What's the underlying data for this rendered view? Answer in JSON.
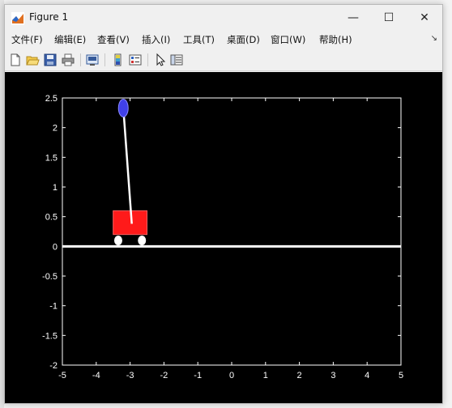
{
  "window": {
    "title": "Figure 1",
    "minimize": "—",
    "maximize": "☐",
    "close": "✕"
  },
  "menu": {
    "items": [
      {
        "label": "文件(F)"
      },
      {
        "label": "编辑(E)"
      },
      {
        "label": "查看(V)"
      },
      {
        "label": "插入(I)"
      },
      {
        "label": "工具(T)"
      },
      {
        "label": "桌面(D)"
      },
      {
        "label": "窗口(W)"
      },
      {
        "label": "帮助(H)"
      }
    ],
    "overflow_icon": "menu-overflow-arrow-icon"
  },
  "toolbar": {
    "icons": [
      "new-figure-icon",
      "open-file-icon",
      "save-icon",
      "print-icon",
      "link-plot-icon",
      "colorbar-icon",
      "legend-icon",
      "edit-plot-pointer-icon",
      "property-inspector-icon"
    ]
  },
  "chart_data": {
    "type": "scatter",
    "xlim": [
      -5,
      5
    ],
    "ylim": [
      -2,
      2.5
    ],
    "xticks": [
      "-5",
      "-4",
      "-3",
      "-2",
      "-1",
      "0",
      "1",
      "2",
      "3",
      "4",
      "5"
    ],
    "yticks": [
      "-2",
      "-1.5",
      "-1",
      "-0.5",
      "0",
      "0.5",
      "1",
      "1.5",
      "2",
      "2.5"
    ],
    "background": "#000000",
    "axis_color": "#ffffff",
    "ground_y": 0,
    "cart": {
      "x_left": -3.5,
      "x_right": -2.5,
      "y_bottom": 0.2,
      "y_top": 0.6,
      "color": "#ff1a1a"
    },
    "wheels": [
      {
        "x": -3.35,
        "y": 0.1
      },
      {
        "x": -2.65,
        "y": 0.1
      }
    ],
    "pendulum": {
      "pivot": [
        -2.95,
        0.38
      ],
      "bob": [
        -3.2,
        2.33
      ],
      "rod_color": "#ffffff",
      "bob_color": "#4040e8"
    }
  }
}
